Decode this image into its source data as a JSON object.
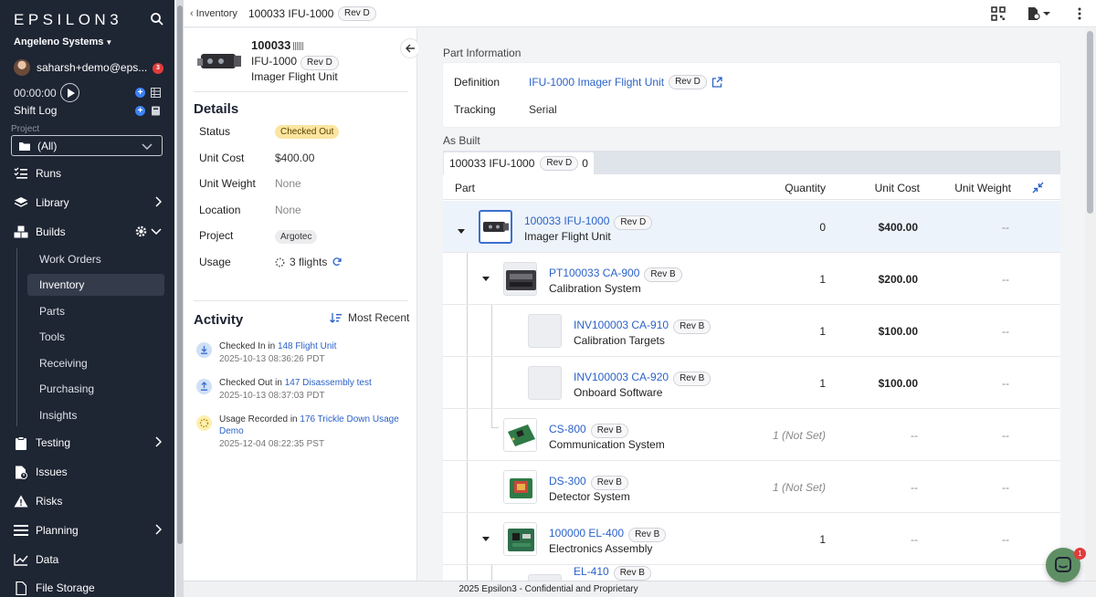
{
  "app": {
    "logo": "EPSILON3",
    "org": "Angeleno Systems",
    "user": "saharsh+demo@eps...",
    "notifications": "3",
    "timer": "00:00:00",
    "shift_log": "Shift Log",
    "project_label": "Project",
    "project_value": "(All)"
  },
  "nav": {
    "runs": "Runs",
    "library": "Library",
    "builds": "Builds",
    "work_orders": "Work Orders",
    "inventory": "Inventory",
    "parts": "Parts",
    "tools": "Tools",
    "receiving": "Receiving",
    "purchasing": "Purchasing",
    "insights": "Insights",
    "testing": "Testing",
    "issues": "Issues",
    "risks": "Risks",
    "planning": "Planning",
    "data": "Data",
    "file_storage": "File Storage"
  },
  "topbar": {
    "back": "Inventory",
    "title": "100033 IFU-1000",
    "rev": "Rev D"
  },
  "part": {
    "number": "100033",
    "code": "IFU-1000",
    "rev": "Rev D",
    "name": "Imager Flight Unit"
  },
  "details": {
    "title": "Details",
    "status_label": "Status",
    "status": "Checked Out",
    "cost_label": "Unit Cost",
    "cost": "$400.00",
    "weight_label": "Unit Weight",
    "weight": "None",
    "location_label": "Location",
    "location": "None",
    "project_label": "Project",
    "project": "Argotec",
    "usage_label": "Usage",
    "usage": "3 flights"
  },
  "activity": {
    "title": "Activity",
    "sort": "Most Recent",
    "items": [
      {
        "action": "Checked In",
        "mid": " in ",
        "link": "148 Flight Unit",
        "time": "2025-10-13 08:36:26 PDT"
      },
      {
        "action": "Checked Out",
        "mid": " in ",
        "link": "147 Disassembly test",
        "time": "2025-10-13 08:37:03 PDT"
      },
      {
        "action": "Usage Recorded",
        "mid": " in ",
        "link": "176 Trickle Down Usage Demo",
        "time": "2025-12-04 08:22:35 PST"
      }
    ]
  },
  "info": {
    "title": "Part Information",
    "definition_label": "Definition",
    "definition": "IFU-1000 Imager Flight Unit",
    "definition_rev": "Rev D",
    "tracking_label": "Tracking",
    "tracking": "Serial"
  },
  "as_built": {
    "title": "As Built",
    "tab_label": "100033 IFU-1000",
    "tab_rev": "Rev D",
    "tab_count": "0",
    "headers": {
      "part": "Part",
      "quantity": "Quantity",
      "cost": "Unit Cost",
      "weight": "Unit Weight"
    },
    "rows": [
      {
        "name": "100033 IFU-1000",
        "rev": "Rev D",
        "desc": "Imager Flight Unit",
        "qty": "0",
        "cost": "$400.00",
        "weight": "--"
      },
      {
        "name": "PT100033 CA-900",
        "rev": "Rev B",
        "desc": "Calibration System",
        "qty": "1",
        "cost": "$200.00",
        "weight": "--"
      },
      {
        "name": "INV100003 CA-910",
        "rev": "Rev B",
        "desc": "Calibration Targets",
        "qty": "1",
        "cost": "$100.00",
        "weight": "--"
      },
      {
        "name": "INV100003 CA-920",
        "rev": "Rev B",
        "desc": "Onboard Software",
        "qty": "1",
        "cost": "$100.00",
        "weight": "--"
      },
      {
        "name": "CS-800",
        "rev": "Rev B",
        "desc": "Communication System",
        "qty": "1 (Not Set)",
        "cost": "--",
        "weight": "--"
      },
      {
        "name": "DS-300",
        "rev": "Rev B",
        "desc": "Detector System",
        "qty": "1 (Not Set)",
        "cost": "--",
        "weight": "--"
      },
      {
        "name": "100000 EL-400",
        "rev": "Rev B",
        "desc": "Electronics Assembly",
        "qty": "1",
        "cost": "--",
        "weight": "--"
      },
      {
        "name": "EL-410",
        "rev": "Rev B",
        "desc": "",
        "qty": "",
        "cost": "",
        "weight": ""
      }
    ]
  },
  "footer": "2025 Epsilon3 - Confidential and Proprietary",
  "chat_badge": "1"
}
